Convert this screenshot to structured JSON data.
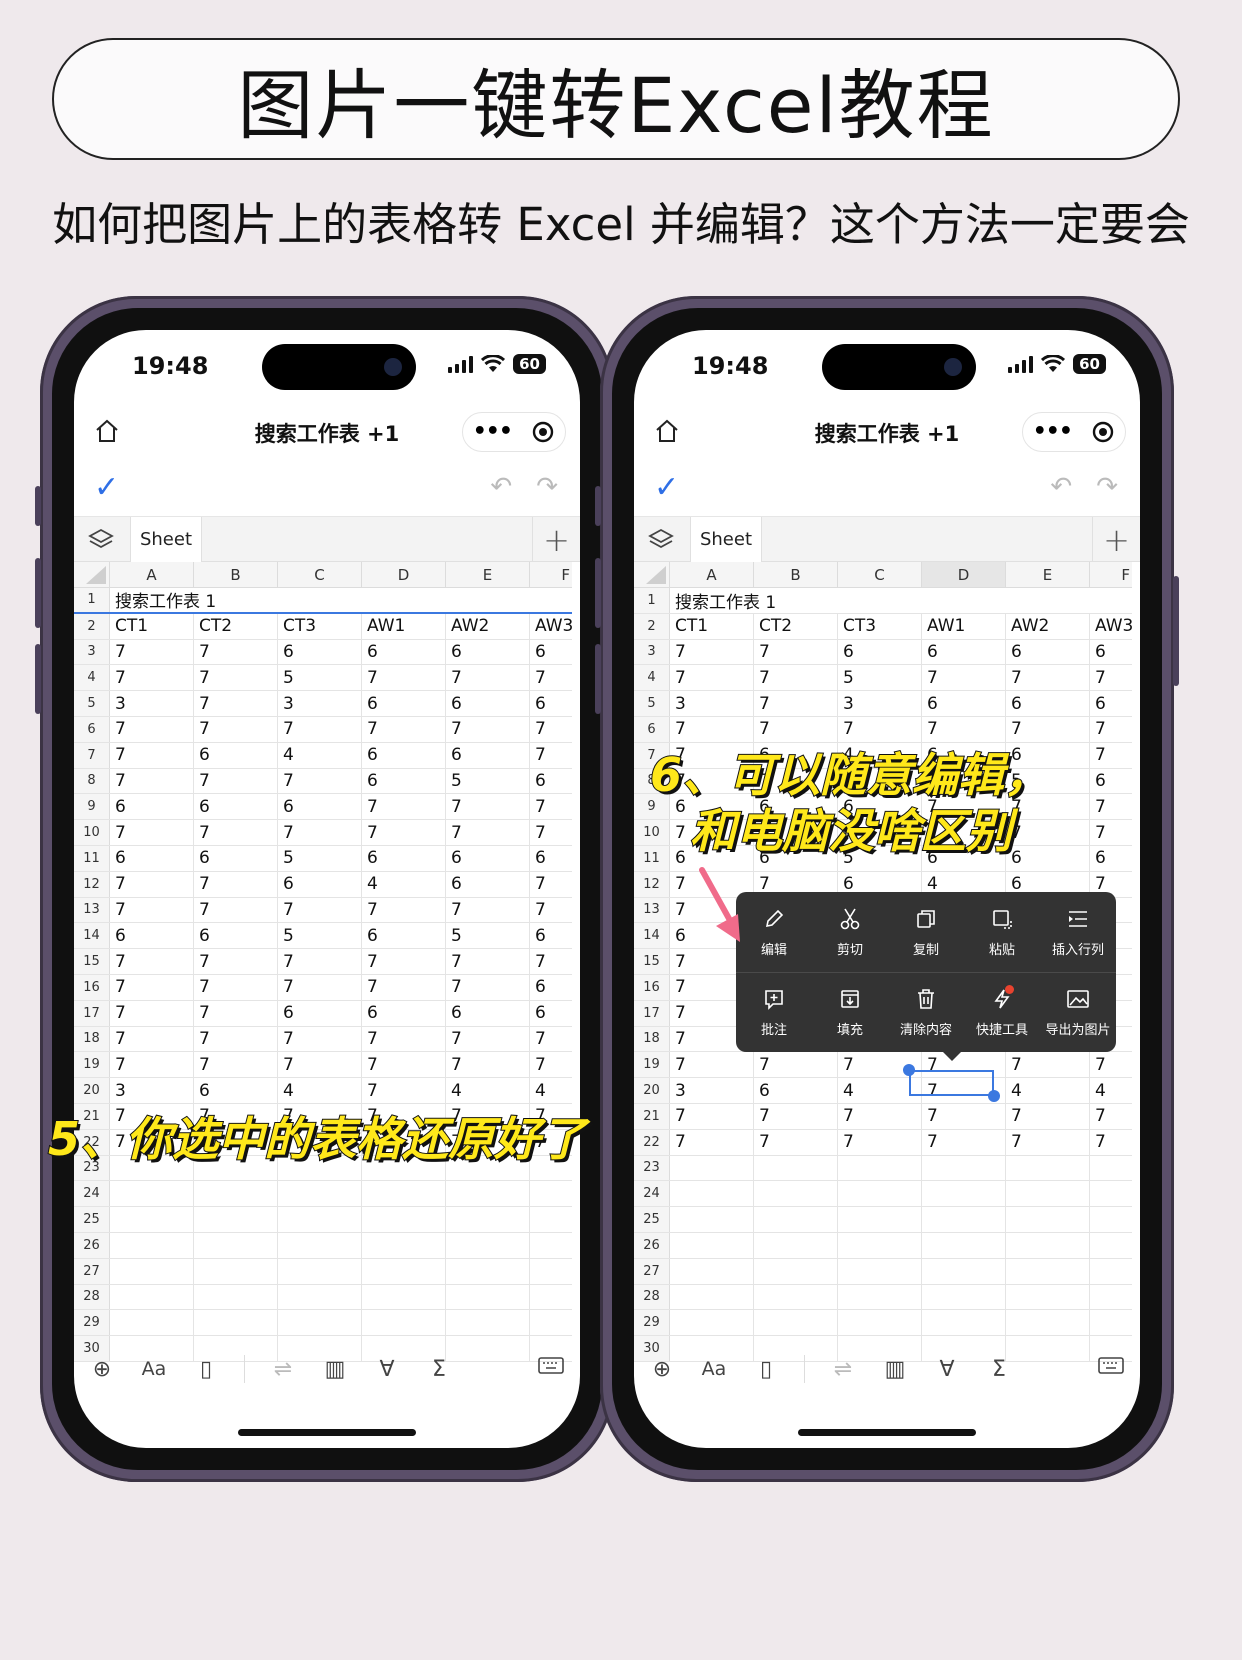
{
  "header": {
    "title": "图片一键转Excel教程",
    "subtitle": "如何把图片上的表格转 Excel 并编辑？这个方法一定要会"
  },
  "colors": {
    "accent": "#2f6fe6",
    "annotation": "#ffe81a",
    "menu_bg": "#333333"
  },
  "phone_left": {
    "time": "19:48",
    "battery": "60",
    "nav_title": "搜索工作表 +1",
    "sheet_tab": "Sheet",
    "columns": [
      "A",
      "B",
      "C",
      "D",
      "E",
      "F"
    ],
    "rows": [
      {
        "n": "1",
        "c": [
          "搜索工作表 1",
          "",
          "",
          "",
          "",
          ""
        ]
      },
      {
        "n": "2",
        "c": [
          "CT1",
          "CT2",
          "CT3",
          "AW1",
          "AW2",
          "AW3"
        ]
      },
      {
        "n": "3",
        "c": [
          "7",
          "7",
          "6",
          "6",
          "6",
          "6"
        ]
      },
      {
        "n": "4",
        "c": [
          "7",
          "7",
          "5",
          "7",
          "7",
          "7"
        ]
      },
      {
        "n": "5",
        "c": [
          "3",
          "7",
          "3",
          "6",
          "6",
          "6"
        ]
      },
      {
        "n": "6",
        "c": [
          "7",
          "7",
          "7",
          "7",
          "7",
          "7"
        ]
      },
      {
        "n": "7",
        "c": [
          "7",
          "6",
          "4",
          "6",
          "6",
          "7"
        ]
      },
      {
        "n": "8",
        "c": [
          "7",
          "7",
          "7",
          "6",
          "5",
          "6"
        ]
      },
      {
        "n": "9",
        "c": [
          "6",
          "6",
          "6",
          "7",
          "7",
          "7"
        ]
      },
      {
        "n": "10",
        "c": [
          "7",
          "7",
          "7",
          "7",
          "7",
          "7"
        ]
      },
      {
        "n": "11",
        "c": [
          "6",
          "6",
          "5",
          "6",
          "6",
          "6"
        ]
      },
      {
        "n": "12",
        "c": [
          "7",
          "7",
          "6",
          "4",
          "6",
          "7"
        ]
      },
      {
        "n": "13",
        "c": [
          "7",
          "7",
          "7",
          "7",
          "7",
          "7"
        ]
      },
      {
        "n": "14",
        "c": [
          "6",
          "6",
          "5",
          "6",
          "5",
          "6"
        ]
      },
      {
        "n": "15",
        "c": [
          "7",
          "7",
          "7",
          "7",
          "7",
          "7"
        ]
      },
      {
        "n": "16",
        "c": [
          "7",
          "7",
          "7",
          "7",
          "7",
          "6"
        ]
      },
      {
        "n": "17",
        "c": [
          "7",
          "7",
          "6",
          "6",
          "6",
          "6"
        ]
      },
      {
        "n": "18",
        "c": [
          "7",
          "7",
          "7",
          "7",
          "7",
          "7"
        ]
      },
      {
        "n": "19",
        "c": [
          "7",
          "7",
          "7",
          "7",
          "7",
          "7"
        ]
      },
      {
        "n": "20",
        "c": [
          "3",
          "6",
          "4",
          "7",
          "4",
          "4"
        ]
      },
      {
        "n": "21",
        "c": [
          "7",
          "7",
          "7",
          "7",
          "7",
          "7"
        ]
      },
      {
        "n": "22",
        "c": [
          "7",
          "7",
          "7",
          "7",
          "7",
          "7"
        ]
      },
      {
        "n": "23",
        "c": [
          "",
          "",
          "",
          "",
          "",
          ""
        ]
      },
      {
        "n": "24",
        "c": [
          "",
          "",
          "",
          "",
          "",
          ""
        ]
      },
      {
        "n": "25",
        "c": [
          "",
          "",
          "",
          "",
          "",
          ""
        ]
      },
      {
        "n": "26",
        "c": [
          "",
          "",
          "",
          "",
          "",
          ""
        ]
      },
      {
        "n": "27",
        "c": [
          "",
          "",
          "",
          "",
          "",
          ""
        ]
      },
      {
        "n": "28",
        "c": [
          "",
          "",
          "",
          "",
          "",
          ""
        ]
      },
      {
        "n": "29",
        "c": [
          "",
          "",
          "",
          "",
          "",
          ""
        ]
      },
      {
        "n": "30",
        "c": [
          "",
          "",
          "",
          "",
          "",
          ""
        ]
      }
    ],
    "annotation": "5、你选中的表格还原好了"
  },
  "phone_right": {
    "time": "19:48",
    "battery": "60",
    "nav_title": "搜索工作表 +1",
    "sheet_tab": "Sheet",
    "annotation_line1": "6、可以随意编辑，",
    "annotation_line2": "和电脑没啥区别",
    "menu_row1": [
      "编辑",
      "剪切",
      "复制",
      "粘贴",
      "插入行列"
    ],
    "menu_row2": [
      "批注",
      "填充",
      "清除内容",
      "快捷工具",
      "导出为图片"
    ]
  }
}
